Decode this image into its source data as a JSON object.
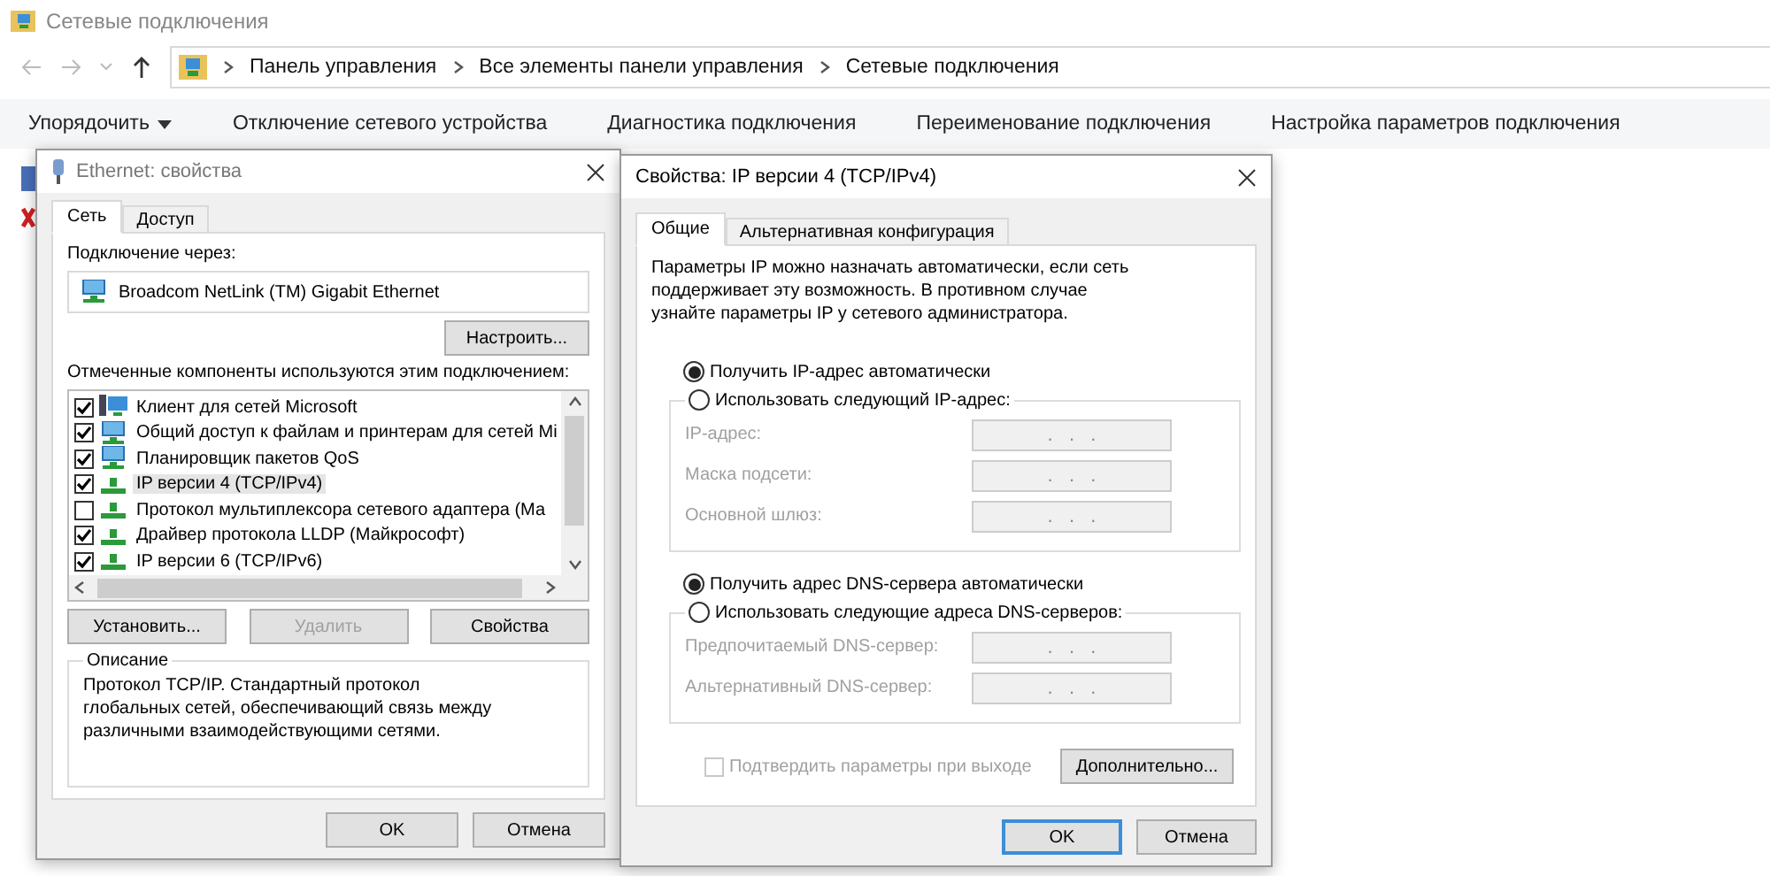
{
  "window": {
    "title": "Сетевые подключения"
  },
  "breadcrumb": [
    "Панель управления",
    "Все элементы панели управления",
    "Сетевые подключения"
  ],
  "toolbar": [
    {
      "label": "Упорядочить",
      "kind": "menu"
    },
    {
      "label": "Отключение сетевого устройства",
      "kind": "command"
    },
    {
      "label": "Диагностика подключения",
      "kind": "command"
    },
    {
      "label": "Переименование подключения",
      "kind": "command"
    },
    {
      "label": "Настройка параметров подключения",
      "kind": "command"
    }
  ],
  "ethernet_dialog": {
    "title": "Ethernet: свойства",
    "tabs": [
      {
        "label": "Сеть",
        "selected": true
      },
      {
        "label": "Доступ",
        "selected": false
      }
    ],
    "connect_via_label": "Подключение через:",
    "adapter": "Broadcom NetLink (TM) Gigabit Ethernet",
    "configure_button": "Настроить...",
    "components_label": "Отмеченные компоненты используются этим подключением:",
    "components": [
      {
        "label": "Клиент для сетей Microsoft",
        "kind": "client",
        "checked": true,
        "selected": false
      },
      {
        "label": "Общий доступ к файлам и принтерам для сетей Mi",
        "kind": "service",
        "checked": true,
        "selected": false
      },
      {
        "label": "Планировщик пакетов QoS",
        "kind": "service",
        "checked": true,
        "selected": false
      },
      {
        "label": "IP версии 4 (TCP/IPv4)",
        "kind": "protocol",
        "checked": true,
        "selected": true
      },
      {
        "label": "Протокол мультиплексора сетевого адаптера (Ма",
        "kind": "protocol",
        "checked": false,
        "selected": false
      },
      {
        "label": "Драйвер протокола LLDP (Майкрософт)",
        "kind": "protocol",
        "checked": true,
        "selected": false
      },
      {
        "label": "IP версии 6 (TCP/IPv6)",
        "kind": "protocol",
        "checked": true,
        "selected": false
      }
    ],
    "buttons": [
      {
        "label": "Установить...",
        "disabled": false
      },
      {
        "label": "Удалить",
        "disabled": true
      },
      {
        "label": "Свойства",
        "disabled": false
      }
    ],
    "description_title": "Описание",
    "description": "Протокол TCP/IP. Стандартный протокол глобальных сетей, обеспечивающий связь между различными взаимодействующими сетями.",
    "footer_buttons": [
      {
        "label": "OK"
      },
      {
        "label": "Отмена"
      }
    ]
  },
  "ip_dialog": {
    "title": "Свойства: IP версии 4 (TCP/IPv4)",
    "tabs": [
      {
        "label": "Общие",
        "selected": true
      },
      {
        "label": "Альтернативная конфигурация",
        "selected": false
      }
    ],
    "intro": "Параметры IP можно назначать автоматически, если сеть поддерживает эту возможность. В противном случае узнайте параметры IP у сетевого администратора.",
    "ip_options": [
      {
        "label": "Получить IP-адрес автоматически",
        "selected": true
      },
      {
        "label": "Использовать следующий IP-адрес:",
        "selected": false
      }
    ],
    "ip_fields": [
      {
        "label": "IP-адрес:",
        "value": ".   .   .",
        "disabled": true
      },
      {
        "label": "Маска подсети:",
        "value": ".   .   .",
        "disabled": true
      },
      {
        "label": "Основной шлюз:",
        "value": ".   .   .",
        "disabled": true
      }
    ],
    "dns_options": [
      {
        "label": "Получить адрес DNS-сервера автоматически",
        "selected": true
      },
      {
        "label": "Использовать следующие адреса DNS-серверов:",
        "selected": false
      }
    ],
    "dns_fields": [
      {
        "label": "Предпочитаемый DNS-сервер:",
        "value": ".   .   .",
        "disabled": true
      },
      {
        "label": "Альтернативный DNS-сервер:",
        "value": ".   .   .",
        "disabled": true
      }
    ],
    "validate": {
      "label": "Подтвердить параметры при выходе",
      "checked": false,
      "disabled": true
    },
    "advanced_button": "Дополнительно...",
    "footer_buttons": [
      {
        "label": "OK",
        "default": true
      },
      {
        "label": "Отмена",
        "default": false
      }
    ]
  }
}
